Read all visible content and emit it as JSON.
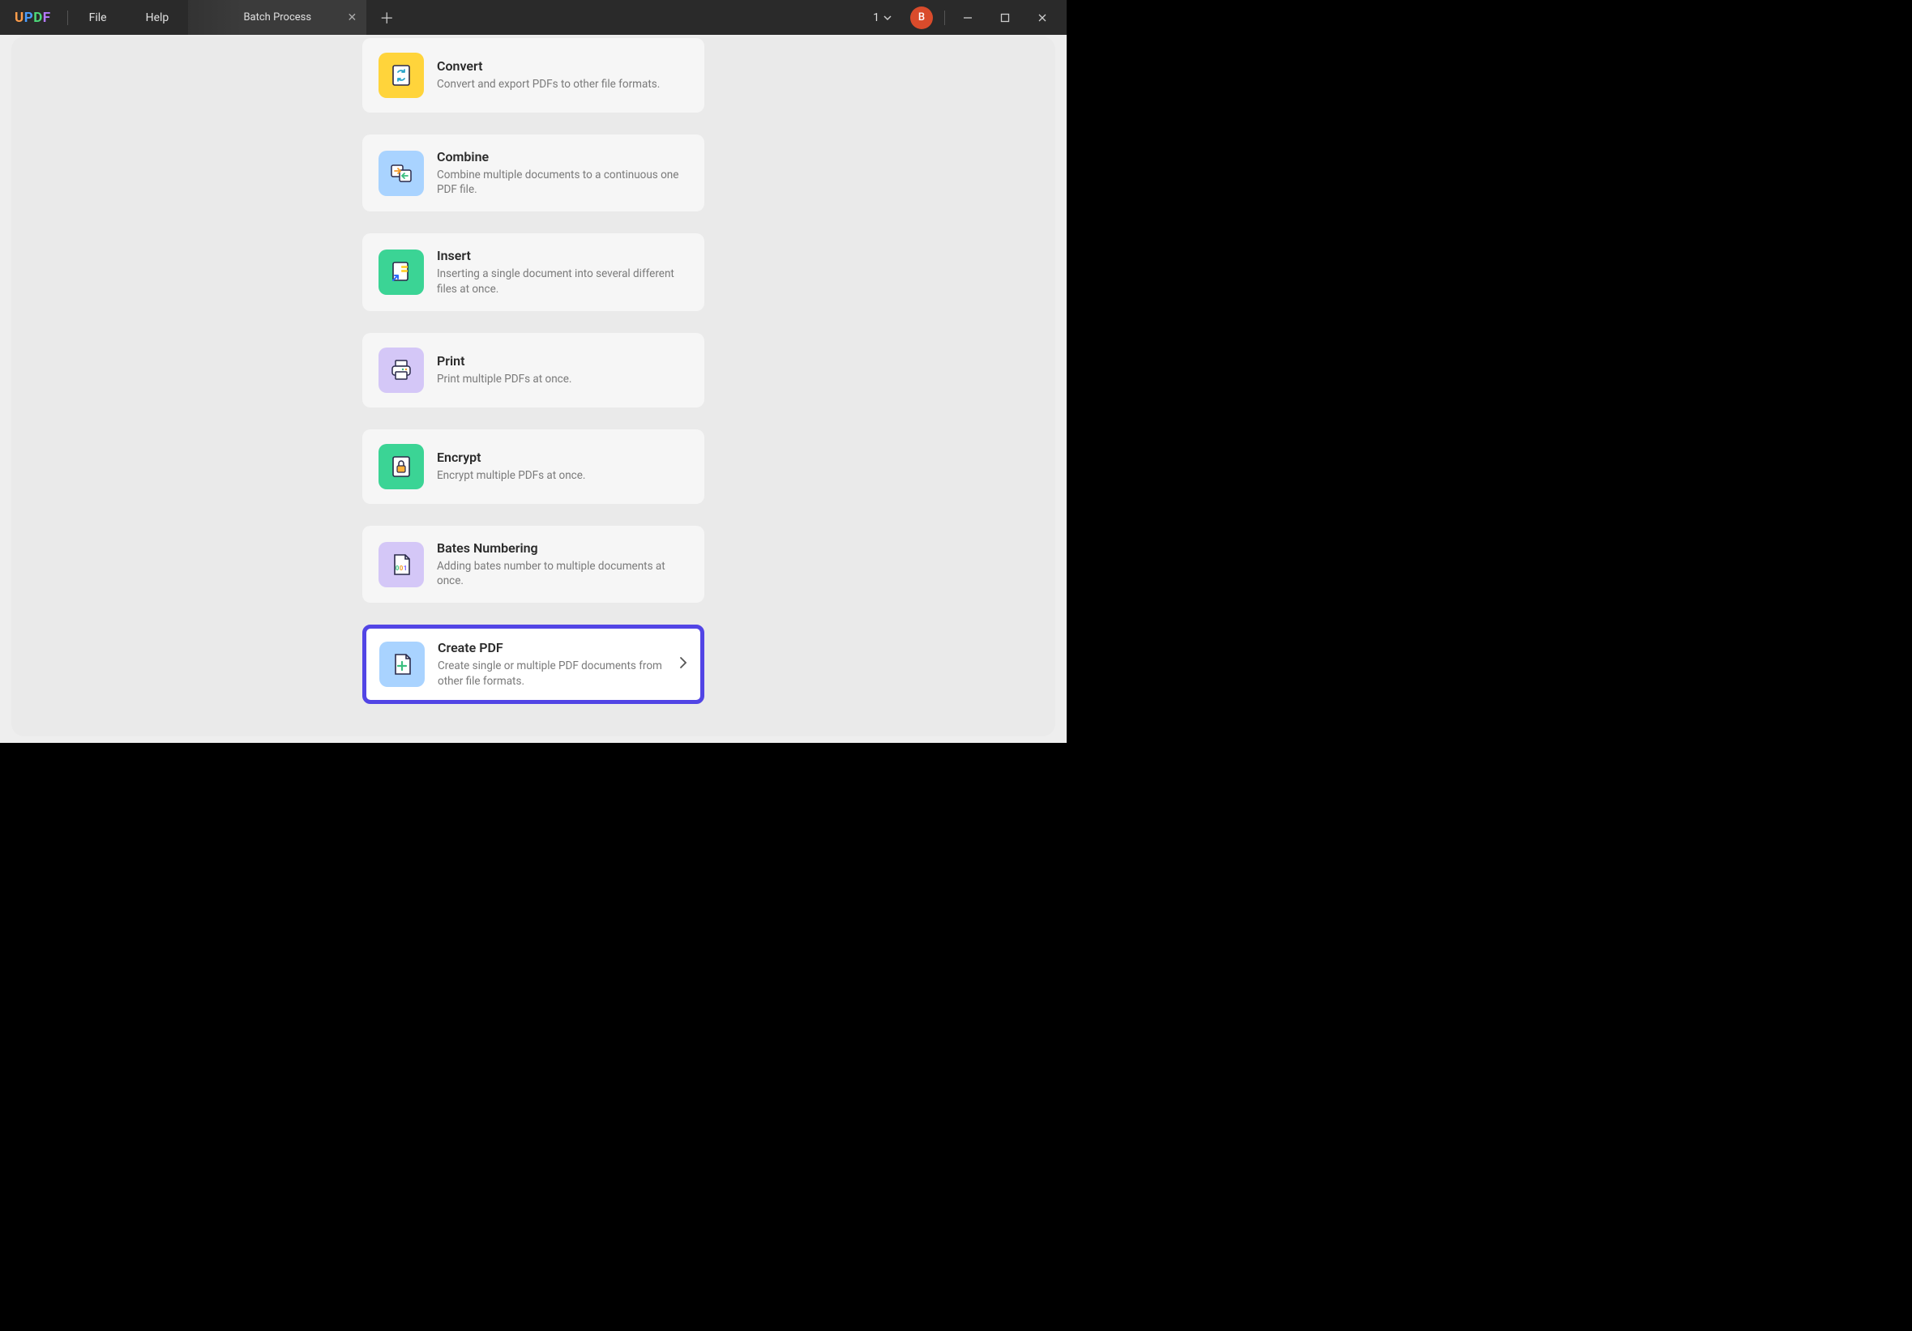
{
  "app": {
    "logo_letters": [
      "U",
      "P",
      "D",
      "F"
    ]
  },
  "menu": {
    "file": "File",
    "help": "Help"
  },
  "tab": {
    "title": "Batch Process"
  },
  "titlebar": {
    "tab_count": "1",
    "avatar_initial": "B"
  },
  "cards": {
    "convert": {
      "title": "Convert",
      "desc": "Convert and export PDFs to other file formats."
    },
    "combine": {
      "title": "Combine",
      "desc": "Combine multiple documents to a continuous one PDF file."
    },
    "insert": {
      "title": "Insert",
      "desc": "Inserting a single document into several different files at once."
    },
    "print": {
      "title": "Print",
      "desc": "Print multiple PDFs at once."
    },
    "encrypt": {
      "title": "Encrypt",
      "desc": "Encrypt multiple PDFs at once."
    },
    "bates": {
      "title": "Bates Numbering",
      "desc": "Adding bates number to multiple documents at once."
    },
    "create": {
      "title": "Create PDF",
      "desc": "Create single or multiple PDF documents from other file formats."
    }
  }
}
